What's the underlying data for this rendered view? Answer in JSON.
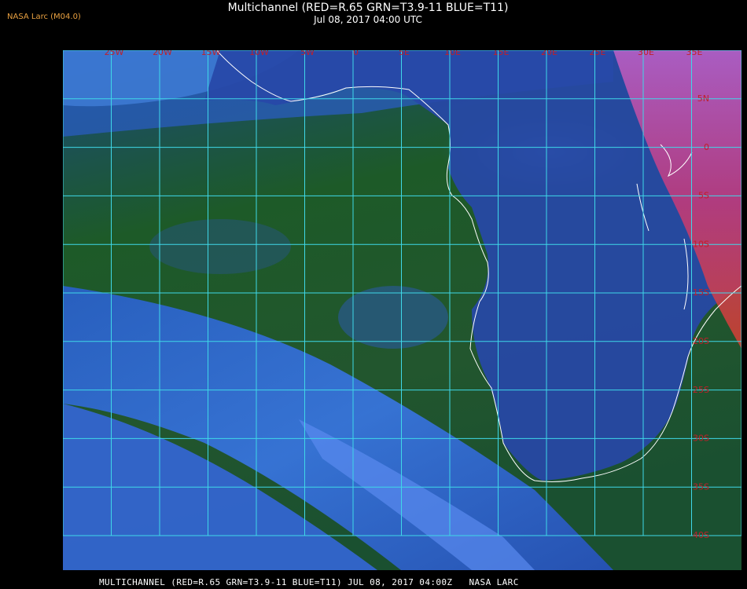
{
  "header": {
    "producer": "NASA Larc (M04.0)",
    "title": "Multichannel (RED=R.65 GRN=T3.9-11 BLUE=T11)",
    "subtitle": "Jul 08, 2017 04:00 UTC"
  },
  "map": {
    "lon_labels": [
      "25W",
      "20W",
      "15W",
      "10W",
      "5W",
      "0",
      "5E",
      "10E",
      "15E",
      "20E",
      "25E",
      "30E",
      "35E"
    ],
    "lat_labels": [
      "5N",
      "0",
      "5S",
      "10S",
      "15S",
      "20S",
      "25S",
      "30S",
      "35S",
      "40S"
    ],
    "colors": {
      "grid": "#3fd8e8",
      "label": "#c0202a",
      "coast": "#ffffff",
      "ocean": "#1f5a2a",
      "land": "#2a4fb0",
      "night_edge": "#c03a8a"
    }
  },
  "footer": {
    "caption": "MULTICHANNEL (RED=R.65 GRN=T3.9-11 BLUE=T11) JUL 08, 2017 04:00Z   NASA LARC"
  }
}
